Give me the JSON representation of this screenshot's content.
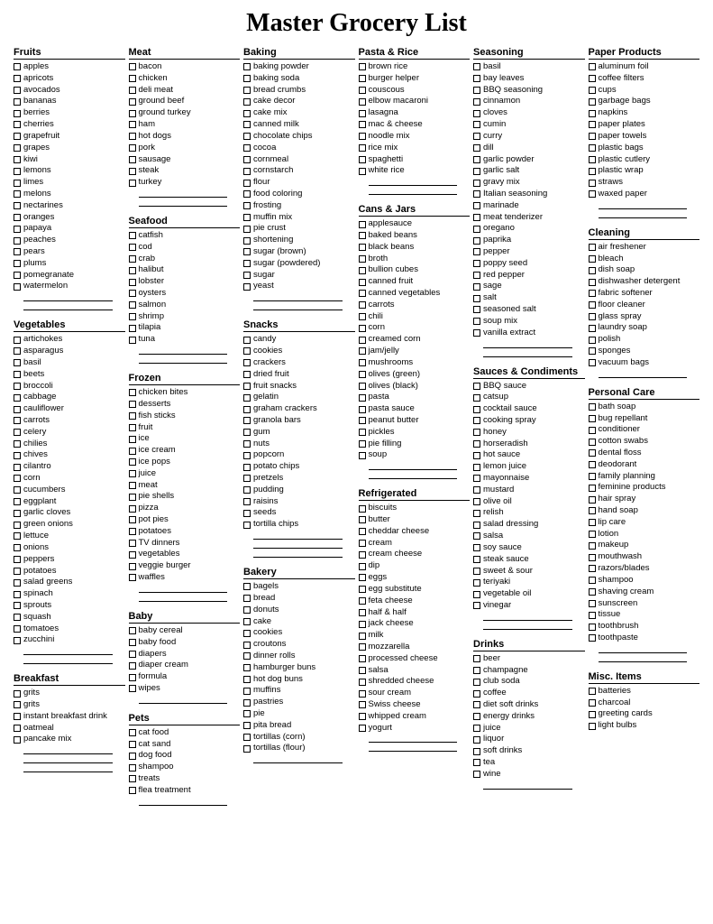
{
  "title": "Master Grocery List",
  "columns": [
    [
      {
        "title": "Fruits",
        "items": [
          "apples",
          "apricots",
          "avocados",
          "bananas",
          "berries",
          "cherries",
          "grapefruit",
          "grapes",
          "kiwi",
          "lemons",
          "limes",
          "melons",
          "nectarines",
          "oranges",
          "papaya",
          "peaches",
          "pears",
          "plums",
          "pomegranate",
          "watermelon"
        ],
        "blanks": 2
      },
      {
        "title": "Vegetables",
        "items": [
          "artichokes",
          "asparagus",
          "basil",
          "beets",
          "broccoli",
          "cabbage",
          "cauliflower",
          "carrots",
          "celery",
          "chilies",
          "chives",
          "cilantro",
          "corn",
          "cucumbers",
          "eggplant",
          "garlic cloves",
          "green onions",
          "lettuce",
          "onions",
          "peppers",
          "potatoes",
          "salad greens",
          "spinach",
          "sprouts",
          "squash",
          "tomatoes",
          "zucchini"
        ],
        "blanks": 2
      },
      {
        "title": "Breakfast",
        "items": [
          "grits",
          "grits",
          "instant breakfast drink",
          "oatmeal",
          "pancake mix"
        ],
        "blanks": 3
      }
    ],
    [
      {
        "title": "Meat",
        "items": [
          "bacon",
          "chicken",
          "deli meat",
          "ground beef",
          "ground turkey",
          "ham",
          "hot dogs",
          "pork",
          "sausage",
          "steak",
          "turkey"
        ],
        "blanks": 2
      },
      {
        "title": "Seafood",
        "items": [
          "catfish",
          "cod",
          "crab",
          "halibut",
          "lobster",
          "oysters",
          "salmon",
          "shrimp",
          "tilapia",
          "tuna"
        ],
        "blanks": 2
      },
      {
        "title": "Frozen",
        "items": [
          "chicken bites",
          "desserts",
          "fish sticks",
          "fruit",
          "ice",
          "ice cream",
          "ice pops",
          "juice",
          "meat",
          "pie shells",
          "pizza",
          "pot pies",
          "potatoes",
          "TV dinners",
          "vegetables",
          "veggie burger",
          "waffles"
        ],
        "blanks": 2
      },
      {
        "title": "Baby",
        "items": [
          "baby cereal",
          "baby food",
          "diapers",
          "diaper cream",
          "formula",
          "wipes"
        ],
        "blanks": 1
      },
      {
        "title": "Pets",
        "items": [
          "cat food",
          "cat sand",
          "dog food",
          "shampoo",
          "treats",
          "flea treatment"
        ],
        "blanks": 1
      }
    ],
    [
      {
        "title": "Baking",
        "items": [
          "baking powder",
          "baking soda",
          "bread crumbs",
          "cake decor",
          "cake mix",
          "canned milk",
          "chocolate chips",
          "cocoa",
          "cornmeal",
          "cornstarch",
          "flour",
          "food coloring",
          "frosting",
          "muffin mix",
          "pie crust",
          "shortening",
          "sugar (brown)",
          "sugar (powdered)",
          "sugar",
          "yeast"
        ],
        "blanks": 2
      },
      {
        "title": "Snacks",
        "items": [
          "candy",
          "cookies",
          "crackers",
          "dried fruit",
          "fruit snacks",
          "gelatin",
          "graham crackers",
          "granola bars",
          "gum",
          "nuts",
          "popcorn",
          "potato chips",
          "pretzels",
          "pudding",
          "raisins",
          "seeds",
          "tortilla chips"
        ],
        "blanks": 3
      },
      {
        "title": "Bakery",
        "items": [
          "bagels",
          "bread",
          "donuts",
          "cake",
          "cookies",
          "croutons",
          "dinner rolls",
          "hamburger buns",
          "hot dog buns",
          "muffins",
          "pastries",
          "pie",
          "pita bread",
          "tortillas (corn)",
          "tortillas (flour)"
        ],
        "blanks": 1
      }
    ],
    [
      {
        "title": "Pasta & Rice",
        "items": [
          "brown rice",
          "burger helper",
          "couscous",
          "elbow macaroni",
          "lasagna",
          "mac & cheese",
          "noodle mix",
          "rice mix",
          "spaghetti",
          "white rice"
        ],
        "blanks": 2
      },
      {
        "title": "Cans & Jars",
        "items": [
          "applesauce",
          "baked beans",
          "black beans",
          "broth",
          "bullion cubes",
          "canned fruit",
          "canned vegetables",
          "carrots",
          "chili",
          "corn",
          "creamed corn",
          "jam/jelly",
          "mushrooms",
          "olives (green)",
          "olives (black)",
          "pasta",
          "pasta sauce",
          "peanut butter",
          "pickles",
          "pie filling",
          "soup"
        ],
        "blanks": 2
      },
      {
        "title": "Refrigerated",
        "items": [
          "biscuits",
          "butter",
          "cheddar cheese",
          "cream",
          "cream cheese",
          "dip",
          "eggs",
          "egg substitute",
          "feta cheese",
          "half & half",
          "jack cheese",
          "milk",
          "mozzarella",
          "processed cheese",
          "salsa",
          "shredded cheese",
          "sour cream",
          "Swiss cheese",
          "whipped cream",
          "yogurt"
        ],
        "blanks": 2
      }
    ],
    [
      {
        "title": "Seasoning",
        "items": [
          "basil",
          "bay leaves",
          "BBQ seasoning",
          "cinnamon",
          "cloves",
          "cumin",
          "curry",
          "dill",
          "garlic powder",
          "garlic salt",
          "gravy mix",
          "Italian seasoning",
          "marinade",
          "meat tenderizer",
          "oregano",
          "paprika",
          "pepper",
          "poppy seed",
          "red pepper",
          "sage",
          "salt",
          "seasoned salt",
          "soup mix",
          "vanilla extract"
        ],
        "blanks": 2
      },
      {
        "title": "Sauces & Condiments",
        "items": [
          "BBQ sauce",
          "catsup",
          "cocktail sauce",
          "cooking spray",
          "honey",
          "horseradish",
          "hot sauce",
          "lemon juice",
          "mayonnaise",
          "mustard",
          "olive oil",
          "relish",
          "salad dressing",
          "salsa",
          "soy sauce",
          "steak sauce",
          "sweet & sour",
          "teriyaki",
          "vegetable oil",
          "vinegar"
        ],
        "blanks": 2
      },
      {
        "title": "Drinks",
        "items": [
          "beer",
          "champagne",
          "club soda",
          "coffee",
          "diet soft drinks",
          "energy drinks",
          "juice",
          "liquor",
          "soft drinks",
          "tea",
          "wine"
        ],
        "blanks": 1
      }
    ],
    [
      {
        "title": "Paper Products",
        "items": [
          "aluminum foil",
          "coffee filters",
          "cups",
          "garbage bags",
          "napkins",
          "paper plates",
          "paper towels",
          "plastic bags",
          "plastic cutlery",
          "plastic wrap",
          "straws",
          "waxed paper"
        ],
        "blanks": 2
      },
      {
        "title": "Cleaning",
        "items": [
          "air freshener",
          "bleach",
          "dish soap",
          "dishwasher detergent",
          "fabric softener",
          "floor cleaner",
          "glass spray",
          "laundry soap",
          "polish",
          "sponges",
          "vacuum bags"
        ],
        "blanks": 1
      },
      {
        "title": "Personal Care",
        "items": [
          "bath soap",
          "bug repellant",
          "conditioner",
          "cotton swabs",
          "dental floss",
          "deodorant",
          "family planning",
          "feminine products",
          "hair spray",
          "hand soap",
          "lip care",
          "lotion",
          "makeup",
          "mouthwash",
          "razors/blades",
          "shampoo",
          "shaving cream",
          "sunscreen",
          "tissue",
          "toothbrush",
          "toothpaste"
        ],
        "blanks": 2
      },
      {
        "title": "Misc. Items",
        "items": [
          "batteries",
          "charcoal",
          "greeting cards",
          "light bulbs"
        ],
        "blanks": 0
      }
    ]
  ]
}
